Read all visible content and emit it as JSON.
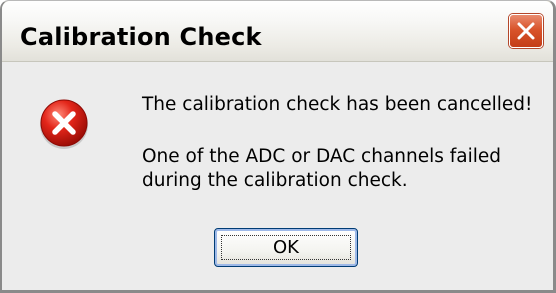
{
  "window": {
    "title": "Calibration Check",
    "close_icon": "close-icon",
    "accent": "#d9542b"
  },
  "dialog": {
    "icon": "error-icon",
    "message_line1": "The calibration check has been cancelled!",
    "message_line2": "One of the ADC or DAC channels failed",
    "message_line3": "during the calibration check.",
    "ok_label": "OK"
  }
}
